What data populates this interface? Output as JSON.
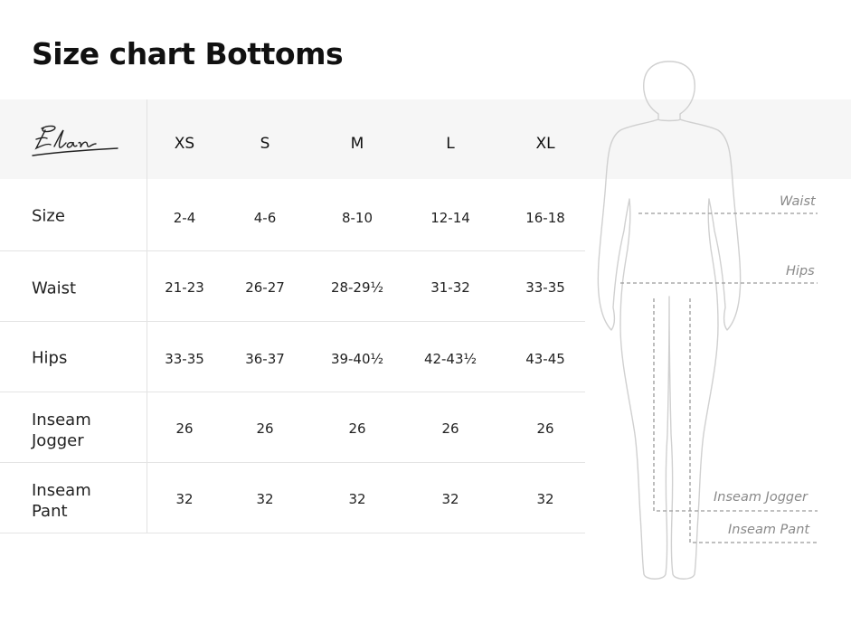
{
  "title": "Size chart Bottoms",
  "brand": "Elan",
  "sizes": [
    "XS",
    "S",
    "M",
    "L",
    "XL"
  ],
  "rows": [
    {
      "label": "Size",
      "values": [
        "2-4",
        "4-6",
        "8-10",
        "12-14",
        "16-18"
      ]
    },
    {
      "label": "Waist",
      "values": [
        "21-23",
        "26-27",
        "28-29½",
        "31-32",
        "33-35"
      ]
    },
    {
      "label": "Hips",
      "values": [
        "33-35",
        "36-37",
        "39-40½",
        "42-43½",
        "43-45"
      ]
    },
    {
      "label": "Inseam\nJogger",
      "values": [
        "26",
        "26",
        "26",
        "26",
        "26"
      ]
    },
    {
      "label": "Inseam\nPant",
      "values": [
        "32",
        "32",
        "32",
        "32",
        "32"
      ]
    }
  ],
  "figure_labels": {
    "waist": "Waist",
    "hips": "Hips",
    "inseam_jogger": "Inseam Jogger",
    "inseam_pant": "Inseam Pant"
  },
  "colors": {
    "header_band": "#f6f6f6",
    "grid_line": "#e4e4e4",
    "figure_outline": "#d0d0d0",
    "measure_line": "#9a9a9a"
  }
}
